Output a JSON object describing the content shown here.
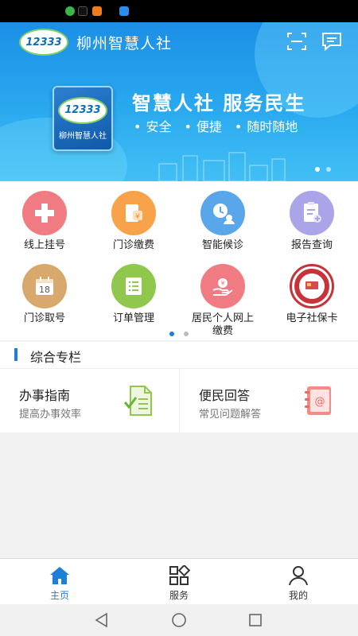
{
  "header": {
    "app_title": "柳州智慧人社",
    "logo_text": "12333",
    "scan_icon": "scan-icon",
    "message_icon": "message-icon"
  },
  "banner": {
    "logo_text": "12333",
    "logo_caption": "柳州智慧人社",
    "slogan": "智慧人社 服务民生",
    "tags": [
      "安全",
      "便捷",
      "随时随地"
    ]
  },
  "services": [
    {
      "label": "线上挂号",
      "icon": "hospital-cross-icon",
      "color": "#f17b82"
    },
    {
      "label": "门诊缴费",
      "icon": "bill-icon",
      "color": "#f8a24a"
    },
    {
      "label": "智能候诊",
      "icon": "waiting-icon",
      "color": "#5aa6ea"
    },
    {
      "label": "报告查询",
      "icon": "report-icon",
      "color": "#a9a5e8"
    },
    {
      "label": "门诊取号",
      "icon": "calendar-icon",
      "color": "#d9a86c"
    },
    {
      "label": "订单管理",
      "icon": "list-icon",
      "color": "#8fc84d"
    },
    {
      "label": "居民个人网上缴费",
      "label_line1": "居民个人网上",
      "label_line2": "缴费",
      "icon": "hand-coin-icon",
      "color": "#f17b82"
    },
    {
      "label": "电子社保卡",
      "icon": "social-security-card-icon",
      "color": "#c8323a"
    }
  ],
  "section": {
    "title": "综合专栏",
    "cards": [
      {
        "title": "办事指南",
        "subtitle": "提高办事效率",
        "icon": "document-check-icon"
      },
      {
        "title": "便民回答",
        "subtitle": "常见问题解答",
        "icon": "address-book-icon"
      }
    ]
  },
  "tabs": [
    {
      "label": "主页",
      "icon": "home-icon",
      "active": true
    },
    {
      "label": "服务",
      "icon": "grid-icon",
      "active": false
    },
    {
      "label": "我的",
      "icon": "user-icon",
      "active": false
    }
  ],
  "colors": {
    "accent": "#1e7fd9",
    "banner": "#2aa9ef"
  }
}
